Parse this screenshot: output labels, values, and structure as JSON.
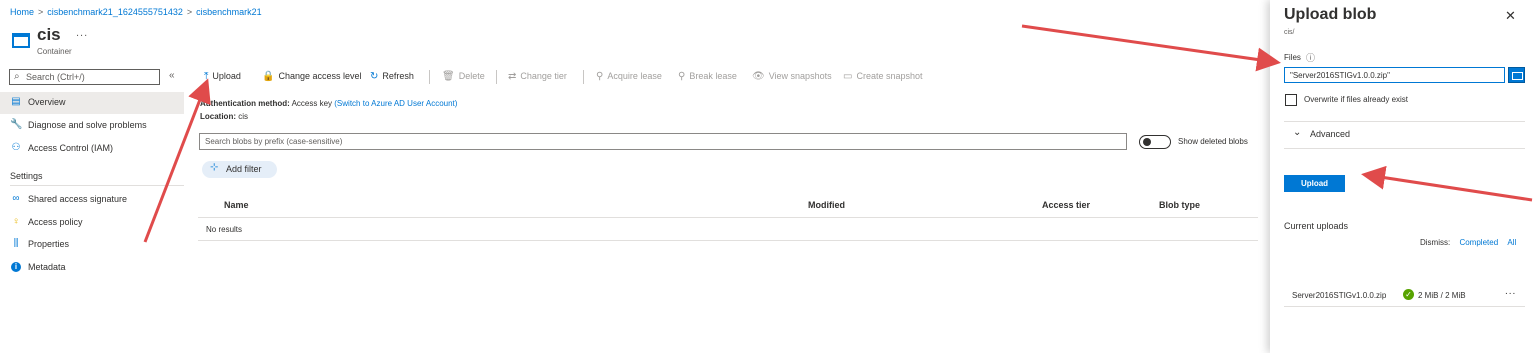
{
  "breadcrumb": [
    "Home",
    "cisbenchmark21_1624555751432",
    "cisbenchmark21"
  ],
  "title": {
    "name": "cis",
    "more": "...",
    "subtitle": "Container"
  },
  "sidebar": {
    "search_placeholder": "Search (Ctrl+/)",
    "collapse": "«",
    "items": [
      {
        "label": "Overview",
        "icon": "overview-icon",
        "selected": true
      },
      {
        "label": "Diagnose and solve problems",
        "icon": "wrench-icon"
      },
      {
        "label": "Access Control (IAM)",
        "icon": "people-icon"
      }
    ],
    "settings_header": "Settings",
    "settings_items": [
      {
        "label": "Shared access signature",
        "icon": "link-icon"
      },
      {
        "label": "Access policy",
        "icon": "key-icon"
      },
      {
        "label": "Properties",
        "icon": "properties-icon"
      },
      {
        "label": "Metadata",
        "icon": "info-icon"
      }
    ]
  },
  "toolbar": {
    "upload": "Upload",
    "change_access": "Change access level",
    "refresh": "Refresh",
    "delete": "Delete",
    "change_tier": "Change tier",
    "acquire_lease": "Acquire lease",
    "break_lease": "Break lease",
    "view_snapshots": "View snapshots",
    "create_snapshot": "Create snapshot"
  },
  "auth": {
    "label": "Authentication method:",
    "value": "Access key",
    "switch_link": "(Switch to Azure AD User Account)",
    "location_label": "Location:",
    "location_value": "cis"
  },
  "blob_search_placeholder": "Search blobs by prefix (case-sensitive)",
  "show_deleted_label": "Show deleted blobs",
  "add_filter_label": "Add filter",
  "table": {
    "columns": [
      "Name",
      "Modified",
      "Access tier",
      "Blob type"
    ],
    "empty_text": "No results"
  },
  "blade": {
    "title": "Upload blob",
    "close": "✕",
    "subtitle": "cis/",
    "files_label": "Files",
    "files_value": "\"Server2016STIGv1.0.0.zip\"",
    "overwrite_label": "Overwrite if files already exist",
    "advanced_label": "Advanced",
    "upload_button": "Upload",
    "current_uploads": "Current uploads",
    "dismiss_label": "Dismiss:",
    "dismiss_completed": "Completed",
    "dismiss_all": "All",
    "upload_item": {
      "file": "Server2016STIGv1.0.0.zip",
      "size": "2 MiB / 2 MiB",
      "more": "..."
    }
  },
  "colors": {
    "accent": "#0078d4",
    "arrow": "#e04b4b",
    "success": "#57a300"
  }
}
